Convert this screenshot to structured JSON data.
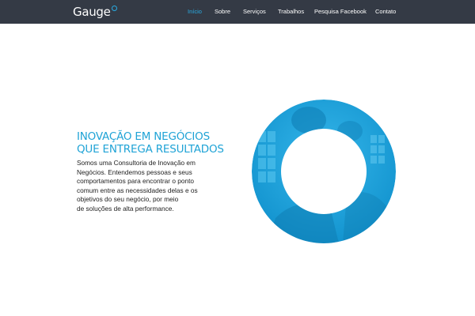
{
  "header": {
    "logo_text": "Gauge",
    "nav": [
      {
        "label": "Início",
        "active": true
      },
      {
        "label": "Sobre",
        "active": false
      },
      {
        "label": "Serviços",
        "active": false
      },
      {
        "label": "Trabalhos",
        "active": false
      },
      {
        "label": "Pesquisa Facebook",
        "active": false
      },
      {
        "label": "Contato",
        "active": false
      }
    ]
  },
  "hero": {
    "heading": "INOVAÇÃO EM NEGÓCIOS\nQUE ENTREGA RESULTADOS",
    "body": "Somos uma Consultoria de Inovação em\nNegócios. Entendemos pessoas e seus\ncomportamentos para encontrar o ponto\ncomum entre as necessidades delas e os\nobjetivos do seu negócio, por meio\nde soluções de alta performance."
  },
  "colors": {
    "nav_background": "#343a45",
    "accent": "#29abe2",
    "ring": "#1ea6e0"
  }
}
